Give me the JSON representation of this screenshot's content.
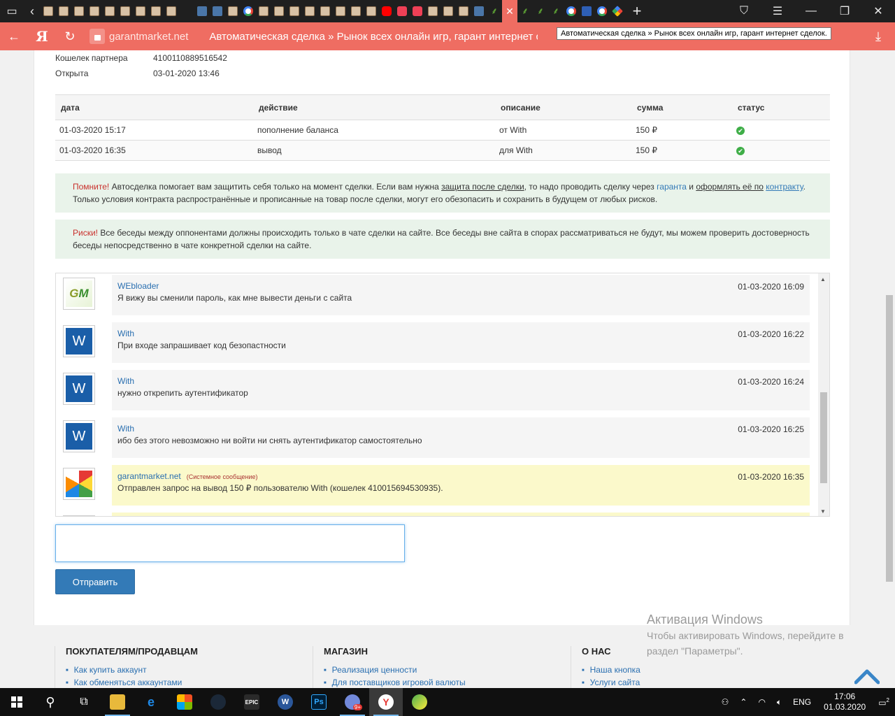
{
  "browser": {
    "tooltip": "Автоматическая сделка » Рынок всех онлайн игр, гарант интернет сделок.",
    "domain": "garantmarket.net",
    "title": "Автоматическая сделка » Рынок всех онлайн игр, гарант интернет сделок.",
    "logo": "Я",
    "tab_icons": [
      "face",
      "face",
      "face",
      "face",
      "face",
      "face",
      "face",
      "face",
      "face",
      "chat",
      "vk",
      "vk",
      "face",
      "google",
      "face",
      "face",
      "face",
      "face",
      "face",
      "face",
      "face",
      "face",
      "yt",
      "pocket",
      "pocket",
      "face",
      "face",
      "face",
      "vk",
      "plant",
      "active",
      "plant",
      "plant",
      "plant",
      "google",
      "blue",
      "google",
      "multi"
    ]
  },
  "deal": {
    "partner_wallet_label": "Кошелек партнера",
    "partner_wallet": "4100110889516542",
    "opened_label": "Открыта",
    "opened": "03-01-2020 13:46"
  },
  "transactions": {
    "headers": [
      "дата",
      "действие",
      "описание",
      "сумма",
      "статус"
    ],
    "rows": [
      {
        "date": "01-03-2020 15:17",
        "action": "пополнение баланса",
        "desc": "от With",
        "amount": "150 ₽",
        "status": "ok"
      },
      {
        "date": "01-03-2020 16:35",
        "action": "вывод",
        "desc": "для With",
        "amount": "150 ₽",
        "status": "ok"
      }
    ]
  },
  "notice1": {
    "title": "Помните!",
    "t1": " Автосделка помогает вам защитить себя только на момент сделки. Если вам нужна ",
    "link1": "защита после сделки",
    "t2": ", то надо проводить сделку через ",
    "link2": "гаранта",
    "t3": " и ",
    "link3": "оформлять её по",
    "link4": "контракту",
    "t4": ". Только условия контракта распространённые и прописанные на товар после сделки, могут его обезопасить и сохранить в будущем от любых рисков."
  },
  "notice2": {
    "title": "Риски!",
    "text": " Все беседы между оппонентами должны происходить только в чате сделки на сайте. Все беседы вне сайта в спорах рассматриваться не будут, мы можем проверить достоверность беседы непосредственно в чате конкретной сделки на сайте."
  },
  "chat": {
    "messages": [
      {
        "author": "WEbloader",
        "time": "01-03-2020 16:09",
        "text": "Я вижу вы сменили пароль, как мне вывести деньги с сайта",
        "avatar": "GM"
      },
      {
        "author": "With",
        "time": "01-03-2020 16:22",
        "text": "При входе запрашивает код безопастности",
        "avatar": "W"
      },
      {
        "author": "With",
        "time": "01-03-2020 16:24",
        "text": "нужно открепить аутентификатор",
        "avatar": "W"
      },
      {
        "author": "With",
        "time": "01-03-2020 16:25",
        "text": "ибо без этого невозможно ни войти ни снять аутентификатор самостоятельно",
        "avatar": "W"
      },
      {
        "author": "garantmarket.net",
        "tag": "(Системное сообщение)",
        "time": "01-03-2020 16:35",
        "text": "Отправлен запрос на вывод 150 ₽ пользователю With (кошелек 410015694530935).",
        "avatar": "cube"
      }
    ],
    "input_value": "",
    "send_label": "Отправить"
  },
  "footer": {
    "col1": {
      "title": "ПОКУПАТЕЛЯМ/ПРОДАВЦАМ",
      "links": [
        "Как купить аккаунт",
        "Как обменяться аккаунтами"
      ]
    },
    "col2": {
      "title": "МАГАЗИН",
      "links": [
        "Реализация ценности",
        "Для поставщиков игровой валюты"
      ]
    },
    "col3": {
      "title": "О НАС",
      "links": [
        "Наша кнопка",
        "Услуги сайта"
      ]
    }
  },
  "windows_activation": {
    "title": "Активация Windows",
    "line1": "Чтобы активировать Windows, перейдите в",
    "line2": "раздел \"Параметры\"."
  },
  "taskbar": {
    "lang": "ENG",
    "time": "17:06",
    "date": "01.03.2020",
    "notifications": "2",
    "discord_badge": "9+",
    "epic_label": "EPIC",
    "ps_label": "Ps",
    "w_label": "W"
  },
  "colors": {
    "browser_accent": "#ef6d62",
    "link": "#337ab7",
    "notice_bg": "#e9f3ea",
    "system_msg_bg": "#fbf9cb",
    "status_ok": "#3fae48"
  }
}
